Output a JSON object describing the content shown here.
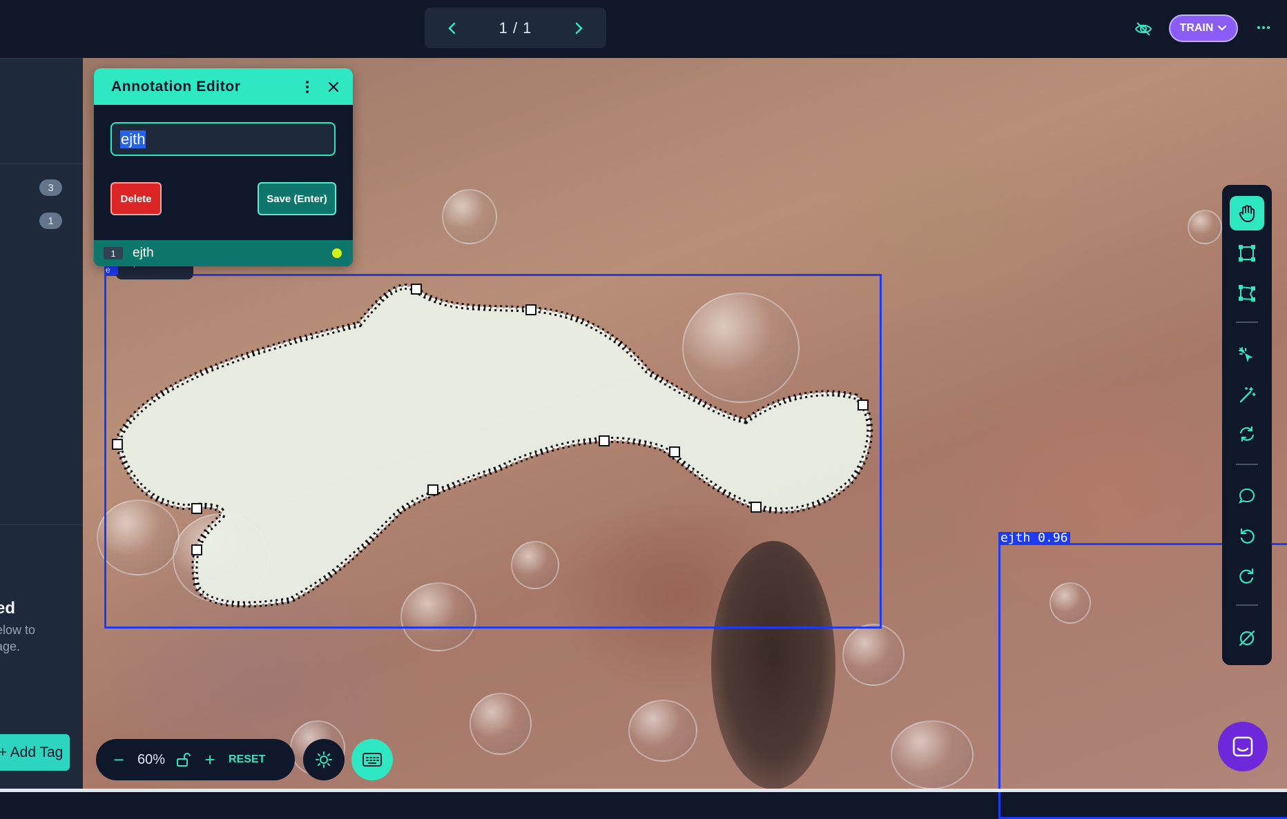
{
  "topbar": {
    "pager": {
      "count": "1 / 1",
      "prev_icon": "chevron-left-icon",
      "next_icon": "chevron-right-icon"
    },
    "visibility_icon": "eye-off-icon",
    "train_button": "TRAIN",
    "more_icon": "more-horizontal-icon"
  },
  "sidebar": {
    "badges": [
      "3",
      "1"
    ],
    "empty_heading": "ed",
    "empty_desc_line1": "elow to",
    "empty_desc_line2": "age.",
    "add_tag": "+ Add Tag"
  },
  "annotation_editor": {
    "title": "Annotation Editor",
    "input_value": "ejth",
    "delete_label": "Delete",
    "save_label": "Save (Enter)",
    "item": {
      "num": "1",
      "label": "ejth",
      "dot_color": "#d4f60e"
    }
  },
  "canvas": {
    "main_box_tag": "e",
    "options_tag": "Options",
    "right_box_label": "ejth 0.96",
    "box_color": "#1d3bf5"
  },
  "toolbar": {
    "tools": [
      "hand-icon",
      "bbox-icon",
      "polygon-icon",
      "smart-select-icon",
      "magic-wand-icon",
      "convert-icon",
      "comment-icon",
      "undo-icon",
      "redo-icon",
      "null-icon"
    ]
  },
  "zoom": {
    "minus": "−",
    "value": "60%",
    "plus": "+",
    "reset": "RESET"
  },
  "colors": {
    "accent": "#2ee8c4",
    "train": "#8b5cf6",
    "danger": "#dc2626",
    "background": "#0f1729"
  }
}
